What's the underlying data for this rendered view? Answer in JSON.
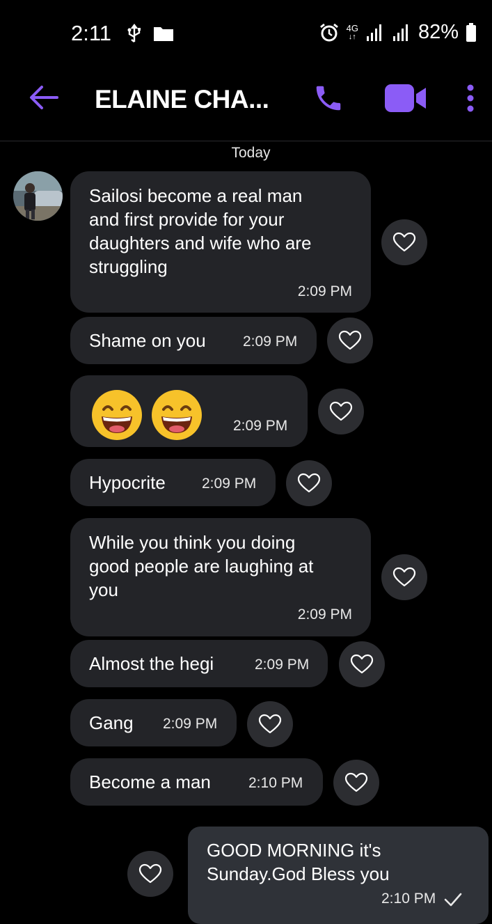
{
  "status_bar": {
    "time": "2:11",
    "network": "4G",
    "battery": "82%"
  },
  "header": {
    "contact_name": "ELAINE CHA...",
    "accent_color": "#8b5cf6"
  },
  "conversation": {
    "date_label": "Today",
    "messages": [
      {
        "text": "Sailosi become a real man\nand first provide for your\ndaughters and wife who are\nstruggling",
        "time": "2:09 PM"
      },
      {
        "text": "Shame on you",
        "time": "2:09 PM"
      },
      {
        "text": "",
        "emoji": "grinning-squinting-face x2",
        "time": "2:09 PM"
      },
      {
        "text": "Hypocrite",
        "time": "2:09 PM"
      },
      {
        "text": "While you think you doing\ngood people are laughing at\nyou",
        "time": "2:09 PM"
      },
      {
        "text": "Almost the hegi",
        "time": "2:09 PM"
      },
      {
        "text": "Gang",
        "time": "2:09 PM"
      },
      {
        "text": "Become a man",
        "time": "2:10 PM"
      }
    ],
    "outgoing": {
      "text": "GOOD MORNING it's\nSunday.God Bless you",
      "time": "2:10 PM",
      "status_icon": "check-icon"
    }
  },
  "icons": {
    "back": "arrow-left-icon",
    "call": "phone-icon",
    "video": "video-camera-icon",
    "menu": "more-vertical-icon",
    "heart": "heart-outline-icon"
  }
}
